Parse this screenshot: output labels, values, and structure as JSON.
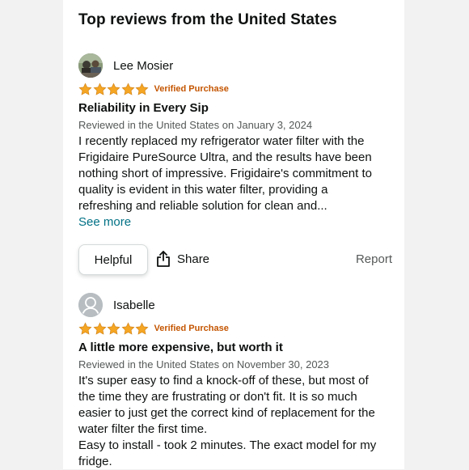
{
  "section": {
    "title": "Top reviews from the United States"
  },
  "colors": {
    "star": "#f5a623",
    "verified": "#c45500",
    "link": "#007185",
    "meta": "#565959"
  },
  "reviews": [
    {
      "author": "Lee Mosier",
      "avatar_icon": "user-photo-avatar",
      "rating": 5,
      "max_rating": 5,
      "verified_label": "Verified Purchase",
      "title": "Reliability in Every Sip",
      "meta": "Reviewed in the United States on January 3, 2024",
      "body_lines": [
        "I recently replaced my refrigerator water filter with the",
        "Frigidaire PureSource Ultra, and the results have been",
        "nothing short of impressive. Frigidaire's commitment to",
        "quality is evident in this water filter, providing a",
        "refreshing and reliable solution for clean and..."
      ],
      "see_more_label": "See more",
      "helpful_label": "Helpful",
      "share_label": "Share",
      "report_label": "Report"
    },
    {
      "author": "Isabelle",
      "avatar_icon": "default-user-avatar-icon",
      "rating": 5,
      "max_rating": 5,
      "verified_label": "Verified Purchase",
      "title": "A little more expensive, but worth it",
      "meta": "Reviewed in the United States on November 30, 2023",
      "body_lines": [
        "It's super easy to find a knock-off of these, but most of",
        "the time they are frustrating or don't fit. It is so much",
        "easier to just get the correct kind of replacement for the",
        "water filter the first time.",
        "Easy to install - took 2 minutes. The exact model for my",
        "fridge."
      ]
    }
  ]
}
